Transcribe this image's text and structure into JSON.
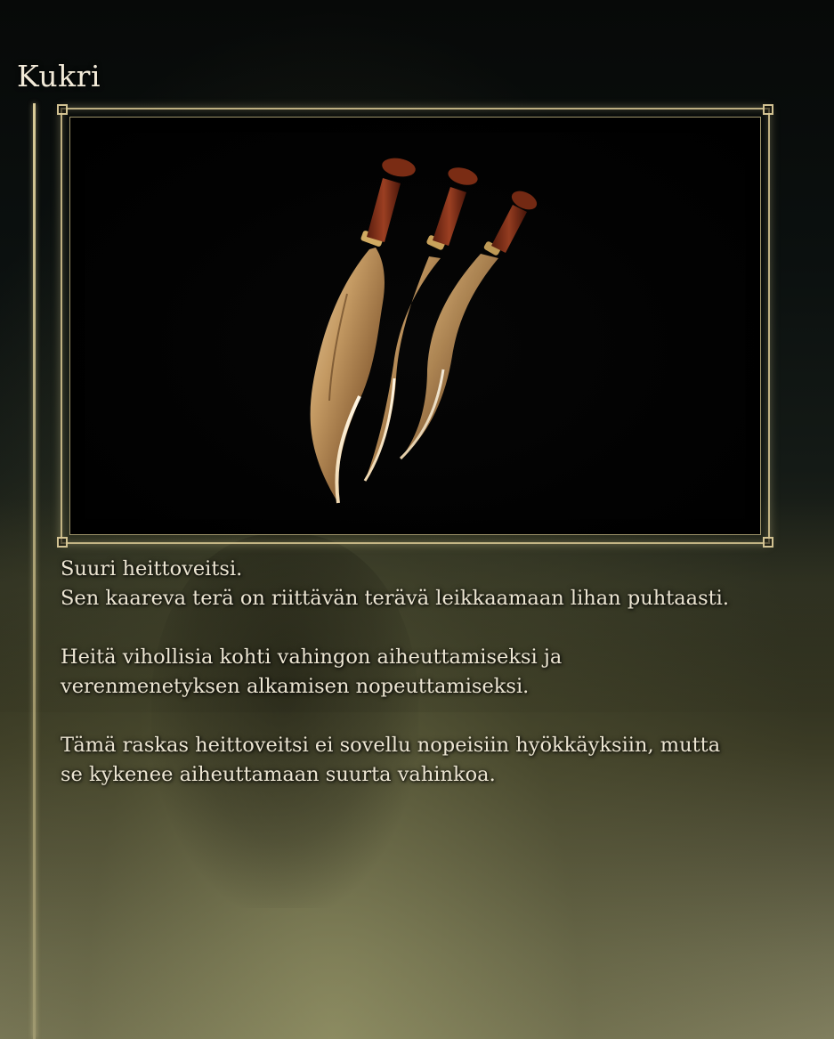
{
  "item": {
    "name": "Kukri",
    "image_icon": "kukri-knives-icon"
  },
  "description": {
    "paragraphs": [
      {
        "lines": [
          "Suuri heittoveitsi.",
          "Sen kaareva terä on riittävän terävä leikkaamaan lihan puhtaasti."
        ]
      },
      {
        "lines": [
          "Heitä vihollisia kohti vahingon aiheuttamiseksi ja",
          "verenmenetyksen alkamisen nopeuttamiseksi."
        ]
      },
      {
        "lines": [
          "Tämä raskas heittoveitsi ei sovellu nopeisiin hyökkäyksiin, mutta",
          "se kykenee aiheuttamaan suurta vahinkoa."
        ]
      }
    ]
  },
  "colors": {
    "frame_gold": "#decd96",
    "text": "#ece5d2"
  }
}
